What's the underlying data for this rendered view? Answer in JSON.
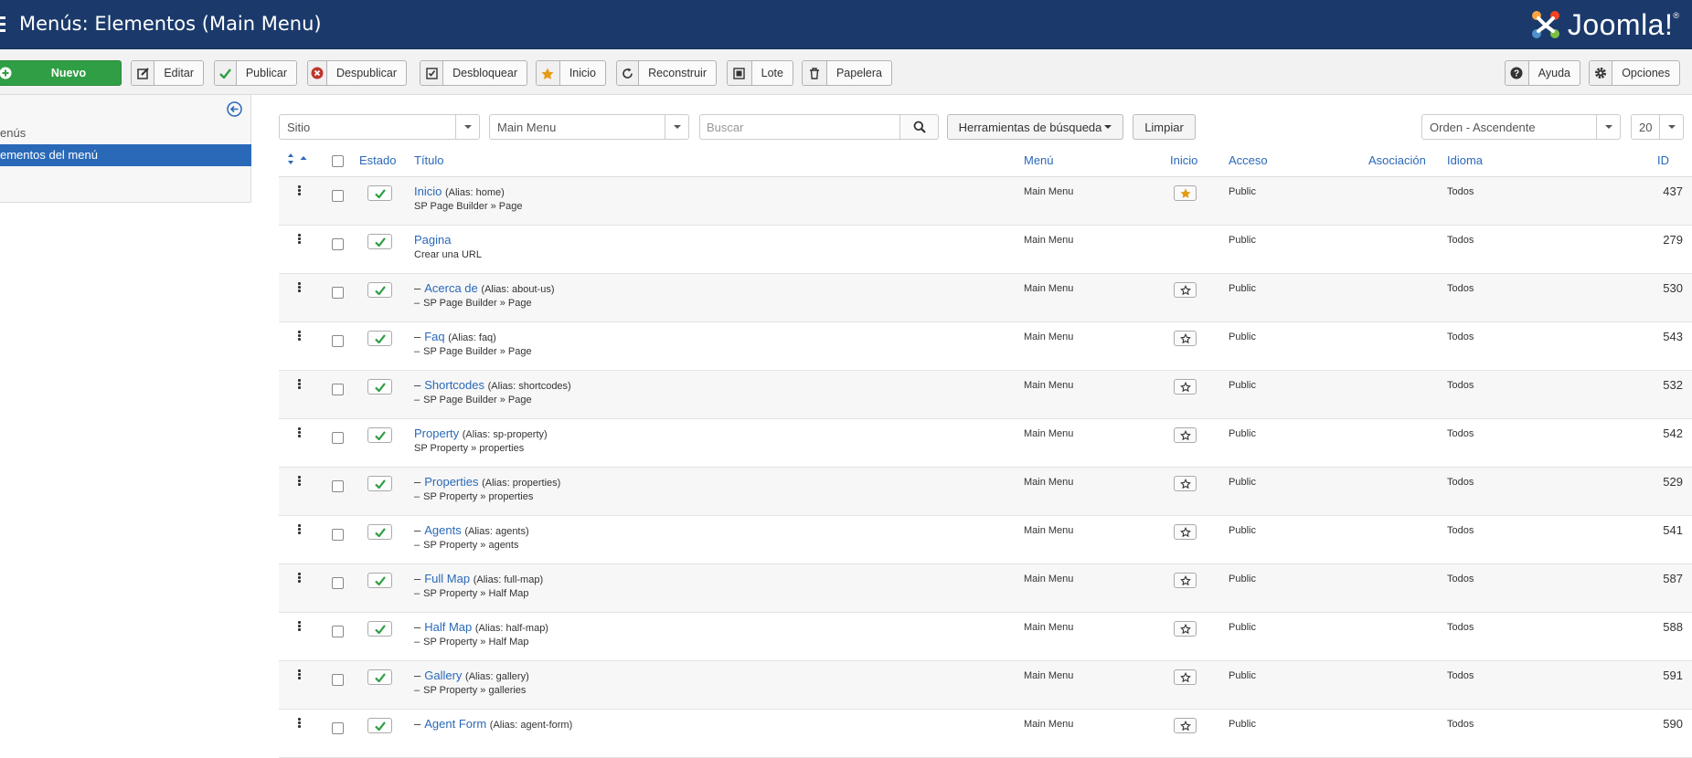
{
  "header": {
    "title": "Menús: Elementos (Main Menu)",
    "logo_text": "Joomla!"
  },
  "toolbar": {
    "new": "Nuevo",
    "edit": "Editar",
    "publish": "Publicar",
    "unpublish": "Despublicar",
    "unlock": "Desbloquear",
    "home": "Inicio",
    "rebuild": "Reconstruir",
    "batch": "Lote",
    "trash": "Papelera",
    "help": "Ayuda",
    "options": "Opciones"
  },
  "sidebar": {
    "items": [
      {
        "label": "enús"
      },
      {
        "label": "ementos del menú"
      }
    ]
  },
  "filters": {
    "site": "Sitio",
    "menu": "Main Menu",
    "search_placeholder": "Buscar",
    "tools": "Herramientas de búsqueda",
    "clear": "Limpiar",
    "order": "Orden - Ascendente",
    "limit": "20"
  },
  "columns": {
    "status": "Estado",
    "title": "Título",
    "menu": "Menú",
    "home": "Inicio",
    "access": "Acceso",
    "association": "Asociación",
    "language": "Idioma",
    "id": "ID"
  },
  "rows": [
    {
      "title": "Inicio",
      "alias": "(Alias: home)",
      "sub": "SP Page Builder » Page",
      "dash": "",
      "sub_dash": "",
      "menu": "Main Menu",
      "home": true,
      "access": "Public",
      "language": "Todos",
      "id": "437"
    },
    {
      "title": "Pagina",
      "alias": "",
      "sub": "Crear una URL",
      "dash": "",
      "sub_dash": "",
      "menu": "Main Menu",
      "home": null,
      "access": "Public",
      "language": "Todos",
      "id": "279"
    },
    {
      "title": "Acerca de",
      "alias": "(Alias: about-us)",
      "sub": "SP Page Builder » Page",
      "dash": "–",
      "sub_dash": "–",
      "menu": "Main Menu",
      "home": false,
      "access": "Public",
      "language": "Todos",
      "id": "530"
    },
    {
      "title": "Faq",
      "alias": "(Alias: faq)",
      "sub": "SP Page Builder » Page",
      "dash": "–",
      "sub_dash": "–",
      "menu": "Main Menu",
      "home": false,
      "access": "Public",
      "language": "Todos",
      "id": "543"
    },
    {
      "title": "Shortcodes",
      "alias": "(Alias: shortcodes)",
      "sub": "SP Page Builder » Page",
      "dash": "–",
      "sub_dash": "–",
      "menu": "Main Menu",
      "home": false,
      "access": "Public",
      "language": "Todos",
      "id": "532"
    },
    {
      "title": "Property",
      "alias": "(Alias: sp-property)",
      "sub": "SP Property » properties",
      "dash": "",
      "sub_dash": "",
      "menu": "Main Menu",
      "home": false,
      "access": "Public",
      "language": "Todos",
      "id": "542"
    },
    {
      "title": "Properties",
      "alias": "(Alias: properties)",
      "sub": "SP Property » properties",
      "dash": "–",
      "sub_dash": "–",
      "menu": "Main Menu",
      "home": false,
      "access": "Public",
      "language": "Todos",
      "id": "529"
    },
    {
      "title": "Agents",
      "alias": "(Alias: agents)",
      "sub": "SP Property » agents",
      "dash": "–",
      "sub_dash": "–",
      "menu": "Main Menu",
      "home": false,
      "access": "Public",
      "language": "Todos",
      "id": "541"
    },
    {
      "title": "Full Map",
      "alias": "(Alias: full-map)",
      "sub": "SP Property » Half Map",
      "dash": "–",
      "sub_dash": "–",
      "menu": "Main Menu",
      "home": false,
      "access": "Public",
      "language": "Todos",
      "id": "587"
    },
    {
      "title": "Half Map",
      "alias": "(Alias: half-map)",
      "sub": "SP Property » Half Map",
      "dash": "–",
      "sub_dash": "–",
      "menu": "Main Menu",
      "home": false,
      "access": "Public",
      "language": "Todos",
      "id": "588"
    },
    {
      "title": "Gallery",
      "alias": "(Alias: gallery)",
      "sub": "SP Property » galleries",
      "dash": "–",
      "sub_dash": "–",
      "menu": "Main Menu",
      "home": false,
      "access": "Public",
      "language": "Todos",
      "id": "591"
    },
    {
      "title": "Agent Form",
      "alias": "(Alias: agent-form)",
      "sub": "",
      "dash": "–",
      "sub_dash": "",
      "menu": "Main Menu",
      "home": false,
      "access": "Public",
      "language": "Todos",
      "id": "590"
    }
  ]
}
